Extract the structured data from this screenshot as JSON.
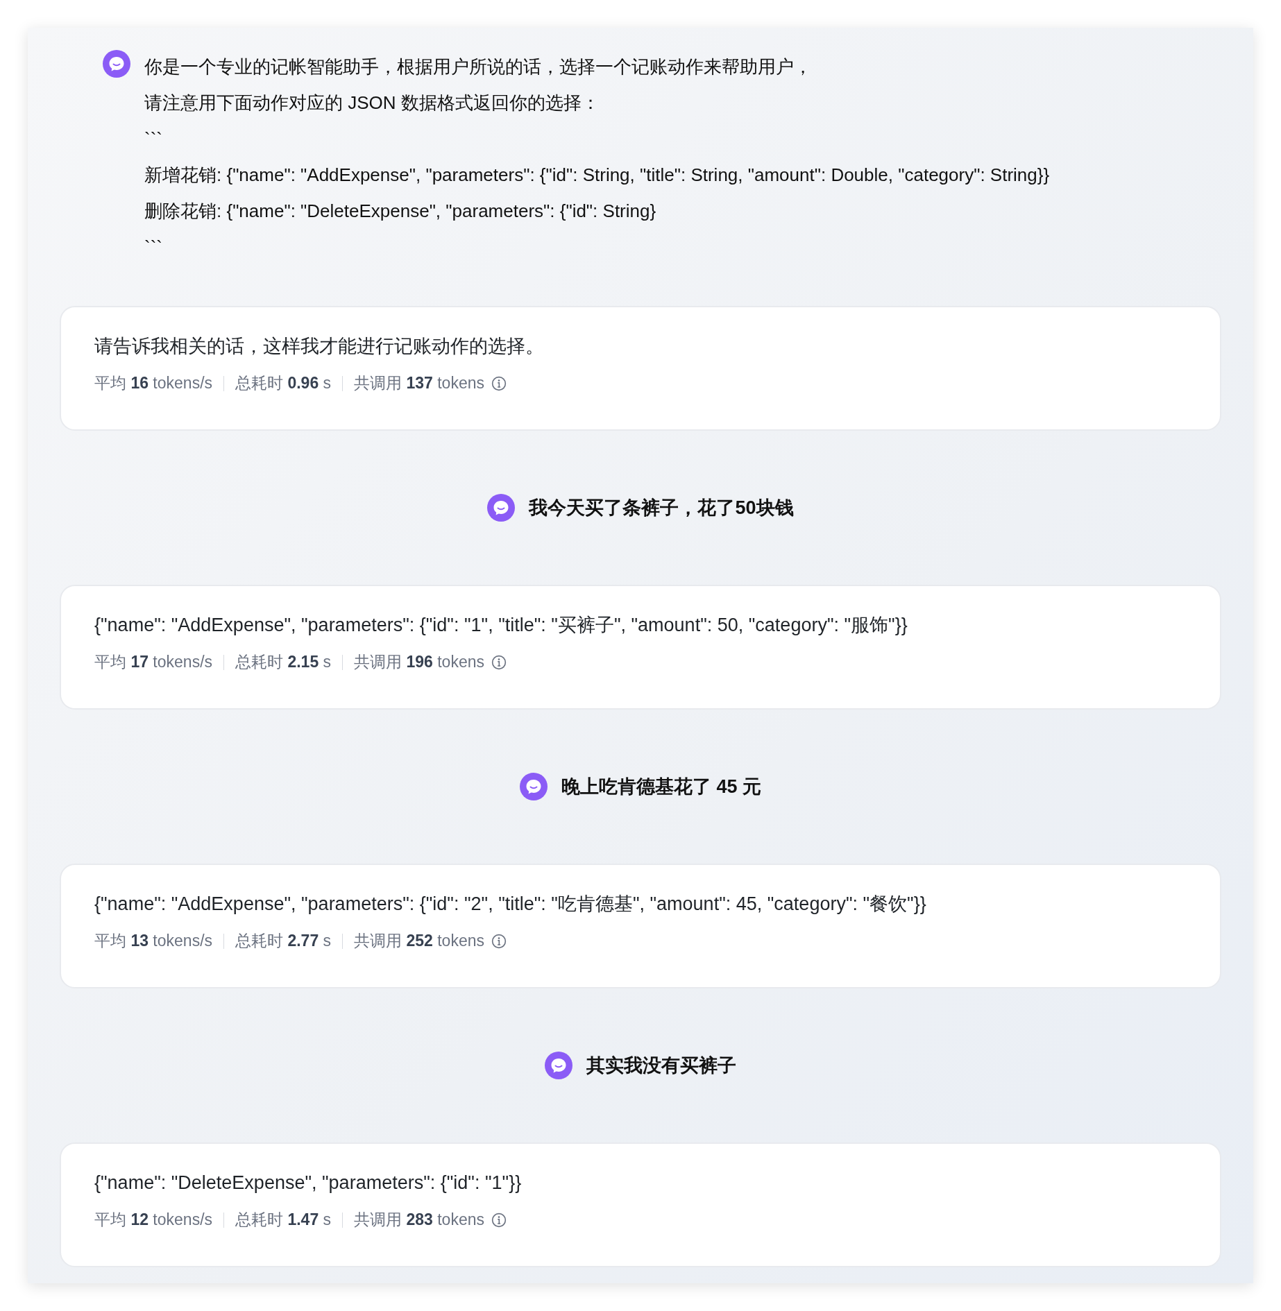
{
  "messages": [
    {
      "kind": "prompt",
      "lines": [
        "你是一个专业的记帐智能助手，根据用户所说的话，选择一个记账动作来帮助用户，",
        "请注意用下面动作对应的 JSON 数据格式返回你的选择：",
        "```",
        "新增花销: {\"name\": \"AddExpense\", \"parameters\": {\"id\": String, \"title\": String, \"amount\": Double, \"category\": String}}",
        "删除花销: {\"name\": \"DeleteExpense\", \"parameters\": {\"id\": String}",
        "```"
      ]
    },
    {
      "kind": "reply",
      "text": "请告诉我相关的话，这样我才能进行记账动作的选择。",
      "stats": [
        {
          "label": "平均",
          "value": "16",
          "unit": "tokens/s"
        },
        {
          "label": "总耗时",
          "value": "0.96",
          "unit": "s"
        },
        {
          "label": "共调用",
          "value": "137",
          "unit": "tokens"
        }
      ]
    },
    {
      "kind": "user",
      "text": "我今天买了条裤子，花了50块钱"
    },
    {
      "kind": "reply",
      "text": "{\"name\": \"AddExpense\", \"parameters\": {\"id\": \"1\", \"title\": \"买裤子\", \"amount\": 50, \"category\": \"服饰\"}}",
      "stats": [
        {
          "label": "平均",
          "value": "17",
          "unit": "tokens/s"
        },
        {
          "label": "总耗时",
          "value": "2.15",
          "unit": "s"
        },
        {
          "label": "共调用",
          "value": "196",
          "unit": "tokens"
        }
      ]
    },
    {
      "kind": "user",
      "text": "晚上吃肯德基花了 45 元"
    },
    {
      "kind": "reply",
      "text": "{\"name\": \"AddExpense\", \"parameters\": {\"id\": \"2\", \"title\": \"吃肯德基\", \"amount\": 45, \"category\": \"餐饮\"}}",
      "stats": [
        {
          "label": "平均",
          "value": "13",
          "unit": "tokens/s"
        },
        {
          "label": "总耗时",
          "value": "2.77",
          "unit": "s"
        },
        {
          "label": "共调用",
          "value": "252",
          "unit": "tokens"
        }
      ]
    },
    {
      "kind": "user",
      "text": "其实我没有买裤子"
    },
    {
      "kind": "reply",
      "text": "{\"name\": \"DeleteExpense\", \"parameters\": {\"id\": \"1\"}}",
      "stats": [
        {
          "label": "平均",
          "value": "12",
          "unit": "tokens/s"
        },
        {
          "label": "总耗时",
          "value": "1.47",
          "unit": "s"
        },
        {
          "label": "共调用",
          "value": "283",
          "unit": "tokens"
        }
      ]
    }
  ]
}
